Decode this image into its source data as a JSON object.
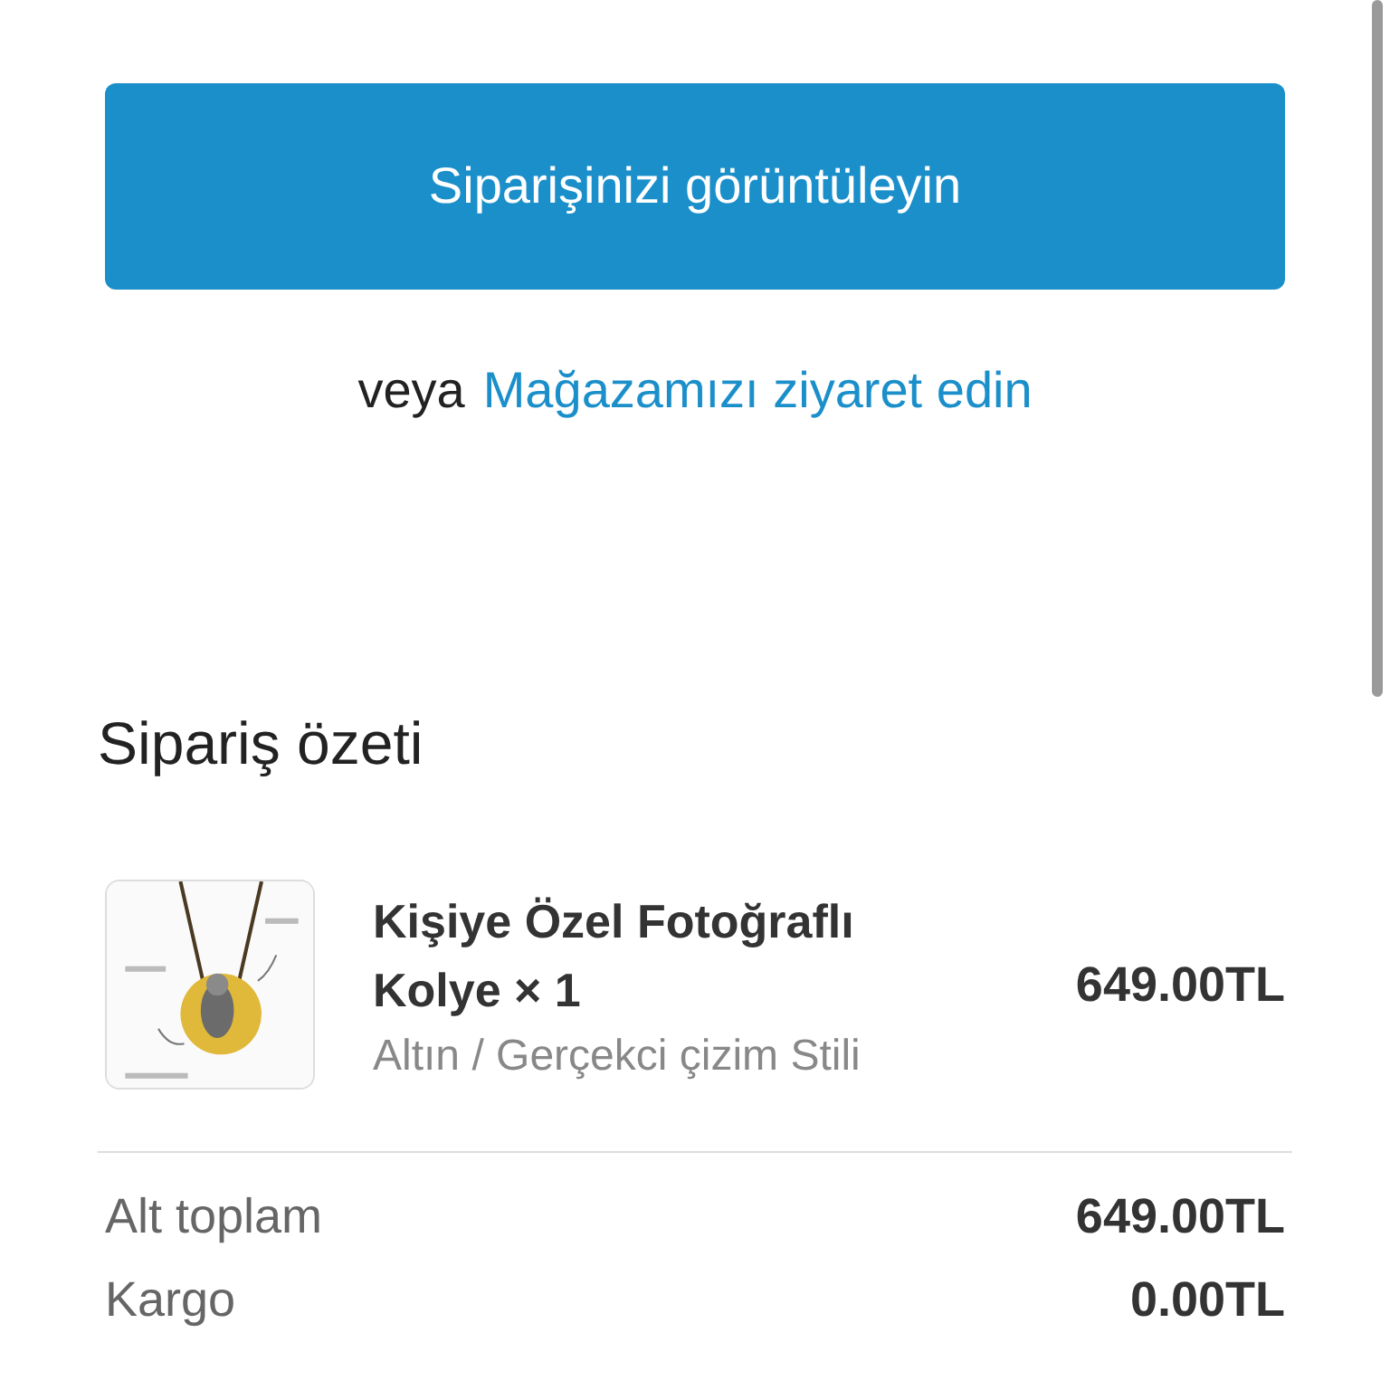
{
  "primary_button": {
    "label": "Siparişinizi görüntüleyin"
  },
  "alt_link": {
    "prefix": "veya",
    "link": "Mağazamızı ziyaret edin"
  },
  "summary": {
    "title": "Sipariş özeti",
    "items": [
      {
        "kind": "picture",
        "name": "Kişiye Özel Fotoğraflı Kolye × 1",
        "variant": "Altın / Gerçekci çizim Stili",
        "price": "649.00TL"
      }
    ],
    "totals": [
      {
        "label": "Alt toplam",
        "value": "649.00TL"
      },
      {
        "label": "Kargo",
        "value": "0.00TL"
      }
    ]
  }
}
